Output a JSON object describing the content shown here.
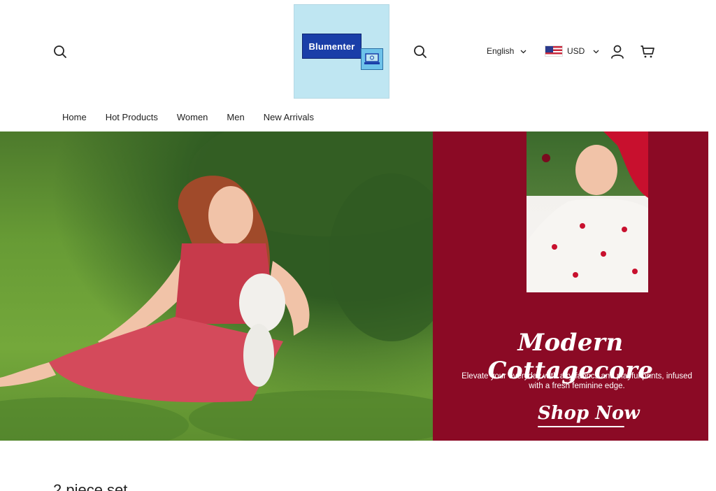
{
  "header": {
    "logo_text": "Blumenter",
    "language": "English",
    "currency": "USD",
    "icons": {
      "search": "search-icon",
      "account": "user-icon",
      "cart": "cart-icon",
      "chevron": "chevron-down-icon",
      "flag": "us-flag-icon"
    }
  },
  "nav": {
    "items": [
      "Home",
      "Hot Products",
      "Women",
      "Men",
      "New Arrivals"
    ]
  },
  "hero": {
    "title": "Modern Cottagecore",
    "subtitle": "Elevate your everyday with airy fabrics and playful prints, infused with a fresh feminine edge.",
    "cta": "Shop Now",
    "panel_color": "#8b0a25"
  },
  "section": {
    "title": "2 piece set"
  }
}
